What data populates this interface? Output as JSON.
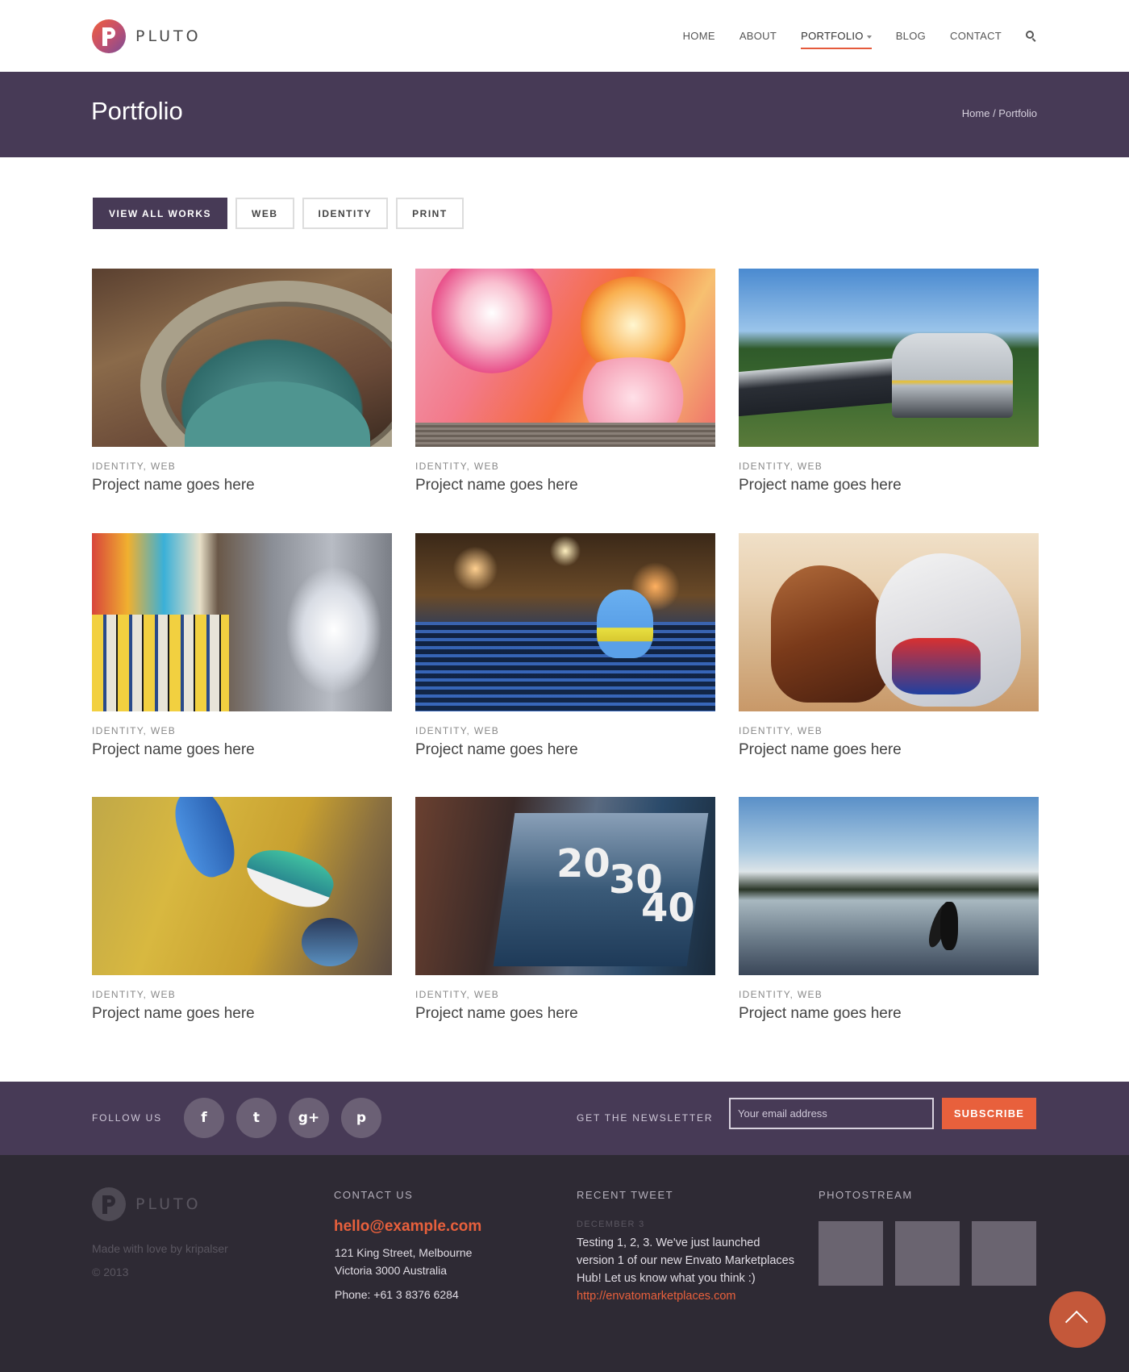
{
  "brand": {
    "name": "PLUTO"
  },
  "nav": {
    "items": [
      {
        "label": "HOME"
      },
      {
        "label": "ABOUT"
      },
      {
        "label": "PORTFOLIO",
        "active": true
      },
      {
        "label": "BLOG"
      },
      {
        "label": "CONTACT"
      }
    ]
  },
  "title_bar": {
    "title": "Portfolio",
    "breadcrumb": "Home / Portfolio"
  },
  "filters": [
    {
      "label": "VIEW ALL WORKS",
      "active": true
    },
    {
      "label": "WEB"
    },
    {
      "label": "IDENTITY"
    },
    {
      "label": "PRINT"
    }
  ],
  "portfolio": [
    {
      "cat1": "IDENTITY",
      "cat2": "WEB",
      "title": "Project name goes here"
    },
    {
      "cat1": "IDENTITY",
      "cat2": "WEB",
      "title": "Project name goes here"
    },
    {
      "cat1": "IDENTITY",
      "cat2": "WEB",
      "title": "Project name goes here"
    },
    {
      "cat1": "IDENTITY",
      "cat2": "WEB",
      "title": "Project name goes here"
    },
    {
      "cat1": "IDENTITY",
      "cat2": "WEB",
      "title": "Project name goes here"
    },
    {
      "cat1": "IDENTITY",
      "cat2": "WEB",
      "title": "Project name goes here"
    },
    {
      "cat1": "IDENTITY",
      "cat2": "WEB",
      "title": "Project name goes here"
    },
    {
      "cat1": "IDENTITY",
      "cat2": "WEB",
      "title": "Project name goes here"
    },
    {
      "cat1": "IDENTITY",
      "cat2": "WEB",
      "title": "Project name goes here"
    }
  ],
  "thumb_numbers": {
    "n1": "20",
    "n2": "30",
    "n3": "40"
  },
  "social_bar": {
    "follow_label": "FOLLOW US",
    "icons": [
      "facebook-icon",
      "twitter-icon",
      "google-plus-icon",
      "pinterest-icon"
    ],
    "icon_glyphs": [
      "f",
      "t",
      "g+",
      "p"
    ],
    "newsletter_label": "GET THE NEWSLETTER",
    "email_placeholder": "Your email address",
    "subscribe_label": "SUBSCRIBE"
  },
  "footer": {
    "brand": "PLUTO",
    "made_with": "Made with love by kripalser",
    "copyright": "© 2013",
    "contact": {
      "heading": "CONTACT US",
      "email": "hello@example.com",
      "address1": "121 King Street, Melbourne",
      "address2": "Victoria 3000 Australia",
      "phone": "Phone: +61 3 8376 6284"
    },
    "tweet": {
      "heading": "RECENT TWEET",
      "date": "DECEMBER 3",
      "text": "Testing 1, 2, 3. We've just launched version 1 of our new Envato Marketplaces Hub! Let us know what you think :) ",
      "link": "http://envatomarketplaces.com"
    },
    "photostream": {
      "heading": "PHOTOSTREAM"
    }
  },
  "colors": {
    "accent": "#e8603c",
    "purple": "#473a56",
    "footer_bg": "#2e2a34"
  }
}
